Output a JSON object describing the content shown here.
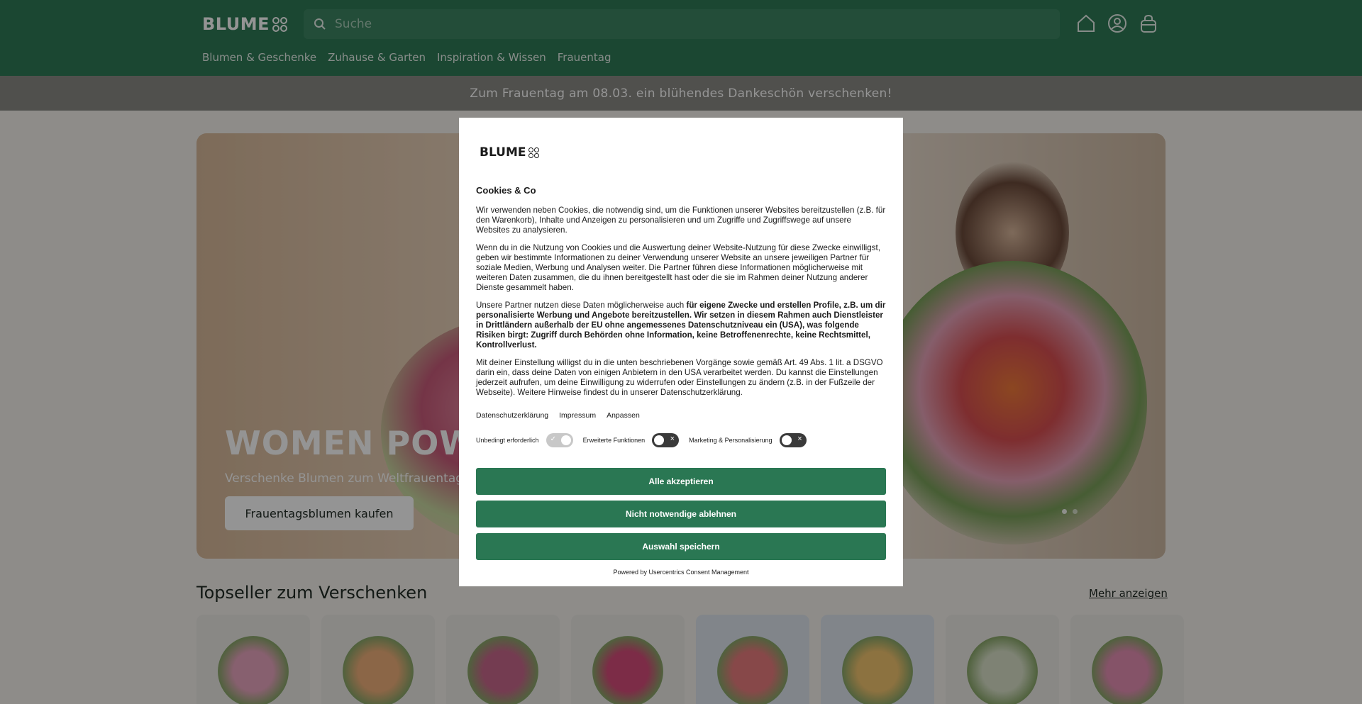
{
  "header": {
    "logo_text": "BLUME",
    "search_placeholder": "Suche",
    "icons": [
      "home-icon",
      "account-icon",
      "cart-bag-icon"
    ],
    "nav": [
      "Blumen & Geschenke",
      "Zuhause & Garten",
      "Inspiration & Wissen",
      "Frauentag"
    ]
  },
  "promo": {
    "text": "Zum Frauentag am 08.03. ein blühendes Dankeschön verschenken!"
  },
  "hero": {
    "title": "WOMEN POWER",
    "subtitle": "Verschenke Blumen zum Weltfrauentag",
    "cta": "Frauentagsblumen kaufen"
  },
  "topseller": {
    "title": "Topseller zum Verschenken",
    "more_link": "Mehr anzeigen",
    "product_colors": [
      "#e9a6bf",
      "#f0b07a",
      "#c9688c",
      "#d64c7a",
      "#e97d7e",
      "#f2c46e",
      "#d9e1c8",
      "#e58fb4"
    ]
  },
  "consent": {
    "logo_text": "BLUME",
    "title": "Cookies & Co",
    "para1": "Wir verwenden neben Cookies, die notwendig sind, um die Funktionen unserer Websites bereitzustellen (z.B. für den Warenkorb), Inhalte und Anzeigen zu personalisieren und um Zugriffe und Zugriffswege auf unsere Websites zu analysieren.",
    "para2": "Wenn du in die Nutzung von Cookies und die Auswertung deiner Website-Nutzung für diese Zwecke einwilligst, geben wir bestimmte Informationen zu deiner Verwendung unserer Website an unsere jeweiligen Partner für soziale Medien, Werbung und Analysen weiter. Die Partner führen diese Informationen möglicherweise mit weiteren Daten zusammen, die du ihnen bereitgestellt hast oder die sie im Rahmen deiner Nutzung anderer Dienste gesammelt haben.",
    "para3_normal": "Unsere Partner nutzen diese Daten möglicherweise auch ",
    "para3_bold": "für eigene Zwecke und erstellen Profile, z.B. um dir personalisierte Werbung und Angebote bereitzustellen. Wir setzen in diesem Rahmen auch Dienstleister in Drittländern außerhalb der EU ohne angemessenes Datenschutzniveau ein (USA), was folgende Risiken birgt: Zugriff durch Behörden ohne Information, keine Betroffenenrechte, keine Rechtsmittel, Kontrollverlust.",
    "para4": "Mit deiner Einstellung willigst du in die unten beschriebenen Vorgänge sowie gemäß Art. 49 Abs. 1 lit. a DSGVO darin ein, dass deine Daten von einigen Anbietern in den USA verarbeitet werden. Du kannst die Einstellungen jederzeit aufrufen, um deine Einwilligung zu widerrufen oder Einstellungen zu ändern (z.B. in der Fußzeile der Webseite). Weitere Hinweise findest du in unserer Datenschutzerklärung.",
    "links": [
      "Datenschutzerklärung",
      "Impressum",
      "Anpassen"
    ],
    "toggles": [
      {
        "label": "Unbedingt erforderlich",
        "state": "on"
      },
      {
        "label": "Erweiterte Funktionen",
        "state": "off"
      },
      {
        "label": "Marketing & Personalisierung",
        "state": "off"
      }
    ],
    "buttons": [
      "Alle akzeptieren",
      "Nicht notwendige ablehnen",
      "Auswahl speichern"
    ],
    "powered_by": "Powered by Usercentrics Consent Management"
  },
  "colors": {
    "header_green": "#2f7a57",
    "button_green": "#2a7753",
    "promo_gray": "#8b8a86"
  }
}
